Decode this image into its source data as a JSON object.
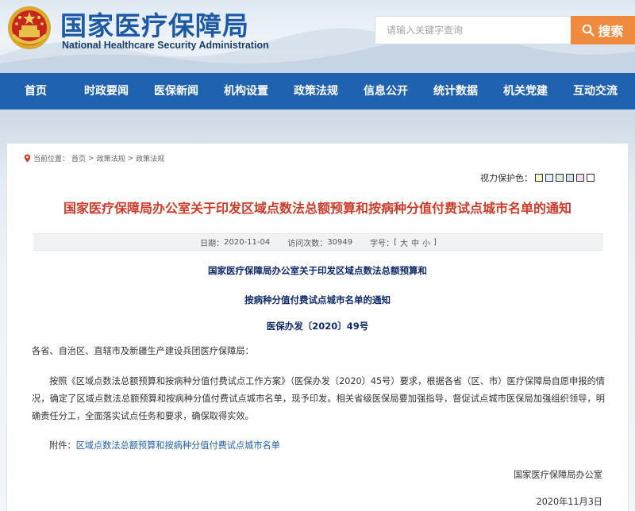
{
  "header": {
    "title": "国家医疗保障局",
    "subtitle": "National Healthcare Security Administration",
    "search_placeholder": "请输入关键字查询",
    "search_button": "搜索"
  },
  "nav": {
    "items": [
      "首页",
      "时政要闻",
      "医保新闻",
      "机构设置",
      "政策法规",
      "信息公开",
      "统计数据",
      "机关党建",
      "互动交流"
    ]
  },
  "breadcrumb": {
    "prefix": "当前位置：",
    "items": [
      "首页",
      "政策法规",
      "政策法规"
    ],
    "separator": ">"
  },
  "eye_protect": {
    "label": "视力保护色：",
    "swatches": [
      "#fff8c6",
      "#d9ecff",
      "#d8eedd",
      "#cfe0f5",
      "#f2d9ee",
      "#ffffff"
    ]
  },
  "article": {
    "title": "国家医疗保障局办公室关于印发区域点数法总额预算和按病种分值付费试点城市名单的通知",
    "meta": {
      "date_label": "日期：",
      "date": "2020-11-04",
      "views_label": "访问次数：",
      "views": "30949",
      "font_label": "字号：",
      "font_open": "[",
      "font_large": "大",
      "font_medium": "中",
      "font_small": "小",
      "font_close": "]"
    },
    "doc_heading_line1": "国家医疗保障局办公室关于印发区域点数法总额预算和",
    "doc_heading_line2": "按病种分值付费试点城市名单的通知",
    "doc_number": "医保办发〔2020〕49号",
    "addressee": "各省、自治区、直辖市及新疆生产建设兵团医疗保障局：",
    "body": "按照《区域点数法总额预算和按病种分值付费试点工作方案》（医保办发〔2020〕45号）要求，根据各省（区、市）医疗保障局自愿申报的情况，确定了区域点数法总额预算和按病种分值付费试点城市名单，现予印发。相关省级医保局要加强指导，督促试点城市医保局加强组织领导，明确责任分工，全面落实试点任务和要求，确保取得实效。",
    "attachment_label": "附件：",
    "attachment_link": "区域点数法总额预算和按病种分值付费试点城市名单",
    "signature_org": "国家医疗保障局办公室",
    "signature_date": "2020年11月3日"
  },
  "colors": {
    "brand_blue": "#1f62b0",
    "title_red": "#d13a28",
    "search_orange": "#f08a3e",
    "heading_navy": "#0e2a6e"
  }
}
